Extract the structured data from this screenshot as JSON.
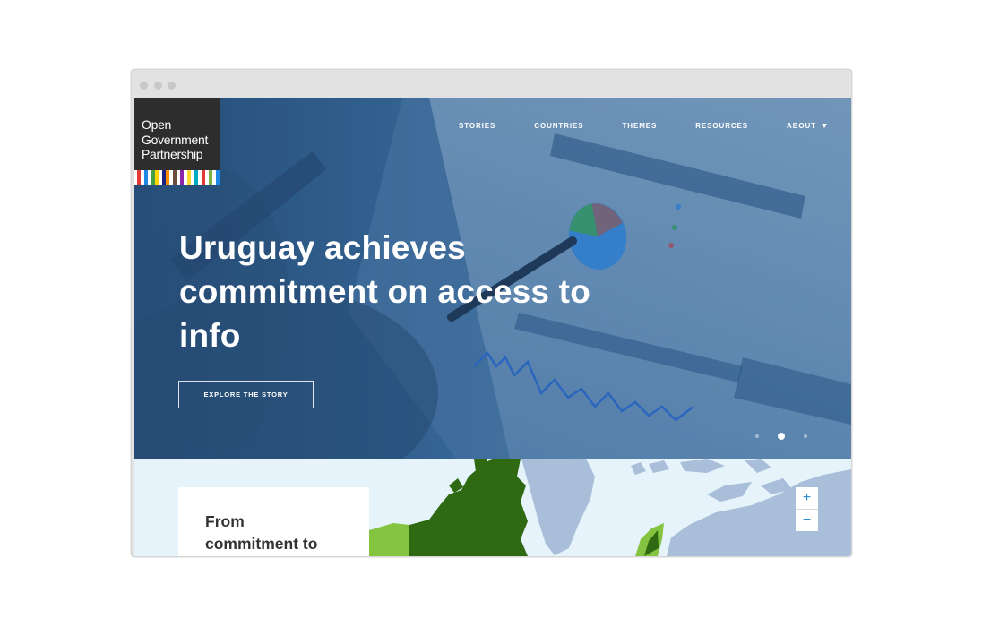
{
  "logo": {
    "line1": "Open",
    "line2": "Government",
    "line3": "Partnership",
    "stripe_colors": [
      "#ffffff",
      "#e53935",
      "#ffffff",
      "#1e88e5",
      "#ffffff",
      "#43a047",
      "#ffd600",
      "#ffffff",
      "#1a237e",
      "#fb8c00",
      "#ffffff",
      "#6d4c41",
      "#ffffff",
      "#8e24aa",
      "#ffffff",
      "#fdd835",
      "#ffffff",
      "#00acc1",
      "#ffffff",
      "#e53935",
      "#ffffff",
      "#7cb342",
      "#ffffff",
      "#1e88e5"
    ]
  },
  "nav": {
    "items": [
      "STORIES",
      "COUNTRIES",
      "THEMES",
      "RESOURCES"
    ],
    "about": "ABOUT",
    "search_icon": "search-icon"
  },
  "hero": {
    "headline": "Uruguay achieves commitment on access to info",
    "cta": "EXPLORE THE STORY",
    "dots_total": 3,
    "active_dot": 2
  },
  "lower": {
    "card_line1": "From",
    "card_line2": "commitment to",
    "zoom_in": "+",
    "zoom_out": "−"
  },
  "colors": {
    "hero_tint": "#3a6a97",
    "logo_bg": "#2d2d2d",
    "map_ocean": "#e6f3fb",
    "map_land": "#a9bfd9",
    "map_green_dark": "#2f6a12",
    "map_green_light": "#84c441",
    "zoom_accent": "#2a8dd6"
  }
}
